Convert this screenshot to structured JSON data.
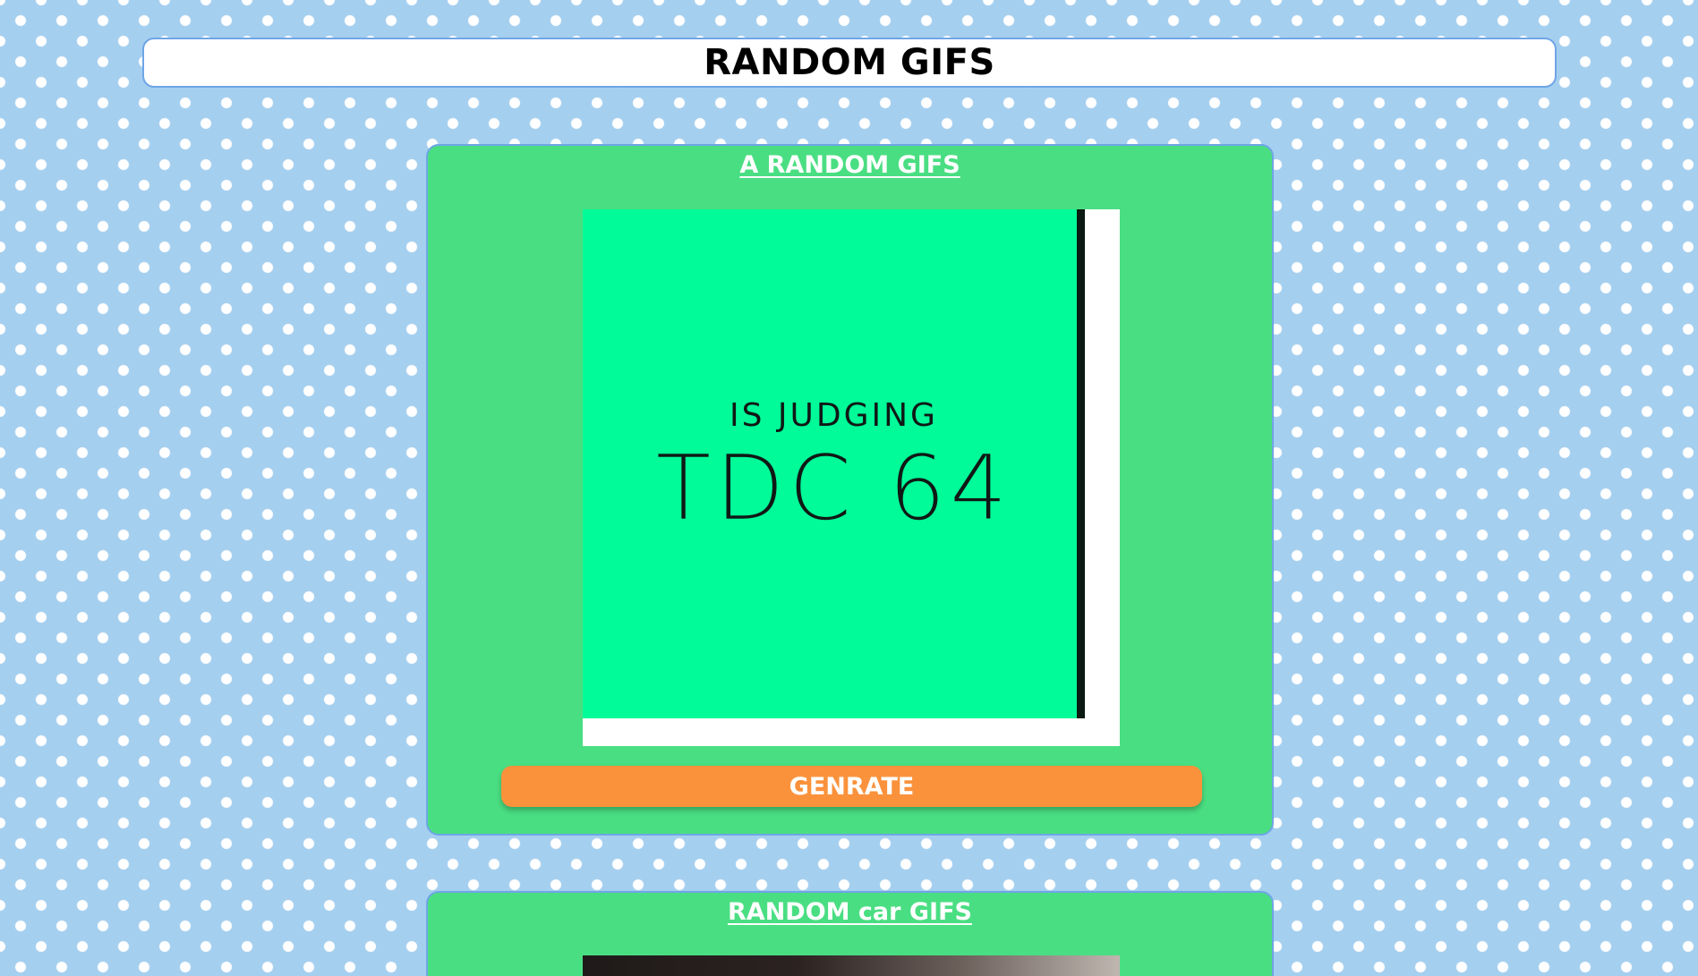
{
  "header": {
    "title": "RANDOM GIFS"
  },
  "cards": [
    {
      "title": "A RANDOM GIFS",
      "gif": {
        "line1": "IS JUDGING",
        "line2": "TDC 64"
      },
      "button_label": "GENRATE"
    },
    {
      "title": "RANDOM car GIFS"
    }
  ],
  "colors": {
    "background": "#a5cfef",
    "card": "#4ade82",
    "card_border": "#6fa5e6",
    "button": "#fa923c",
    "gif_background": "#00fb98"
  }
}
